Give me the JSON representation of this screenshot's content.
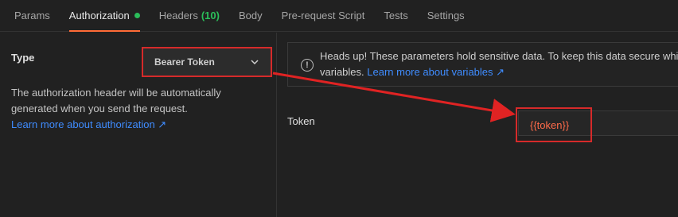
{
  "tabs": [
    {
      "label": "Params"
    },
    {
      "label": "Authorization",
      "status_dot_color": "#2bbd5a"
    },
    {
      "label": "Headers",
      "count": "(10)",
      "count_color": "#2bbd5a"
    },
    {
      "label": "Body"
    },
    {
      "label": "Pre-request Script"
    },
    {
      "label": "Tests"
    },
    {
      "label": "Settings"
    }
  ],
  "auth": {
    "type_label": "Type",
    "type_value": "Bearer Token",
    "description": "The authorization header will be automatically generated when you send the request.",
    "learn_more": "Learn more about authorization ↗"
  },
  "alert": {
    "text": "Heads up! These parameters hold sensitive data. To keep this data secure while working in a collaborative environment, we recommend using variables.",
    "line2": "variables.",
    "learn_more": "Learn more about variables ↗"
  },
  "token": {
    "label": "Token",
    "value": "{{token}}"
  },
  "colors": {
    "accent": "#ff6c37",
    "highlight": "#d62a2a",
    "link": "#3f8cff"
  }
}
